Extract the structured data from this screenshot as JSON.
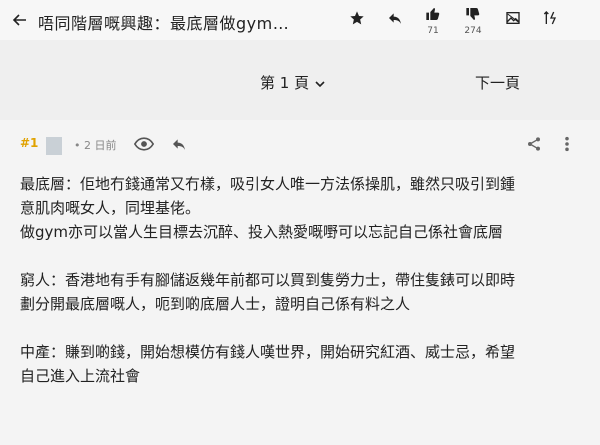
{
  "header": {
    "title": "唔同階層嘅興趣：最底層做gym…",
    "likes": "71",
    "dislikes": "274"
  },
  "pager": {
    "current_page": "第 1 頁",
    "next_page": "下一頁"
  },
  "post": {
    "number": "#1",
    "time": "2 日前",
    "lines": [
      "最底層：佢地冇錢通常又冇樣，吸引女人唯一方法係操肌，雖然只吸引到鍾",
      "意肌肉嘅女人，同埋基佬。",
      "做gym亦可以當人生目標去沉醉、投入熱愛嘅嘢可以忘記自己係社會底層",
      "",
      "窮人：香港地有手有腳儲返幾年前都可以買到隻勞力士，帶住隻錶可以即時",
      "劃分開最底層嘅人，呃到啲底層人士，證明自己係有料之人",
      "",
      "中產：賺到啲錢，開始想模仿有錢人嘆世界，開始研究紅酒、威士忌，希望",
      "自己進入上流社會"
    ]
  },
  "colors": {
    "post_number": "#e0a200"
  }
}
